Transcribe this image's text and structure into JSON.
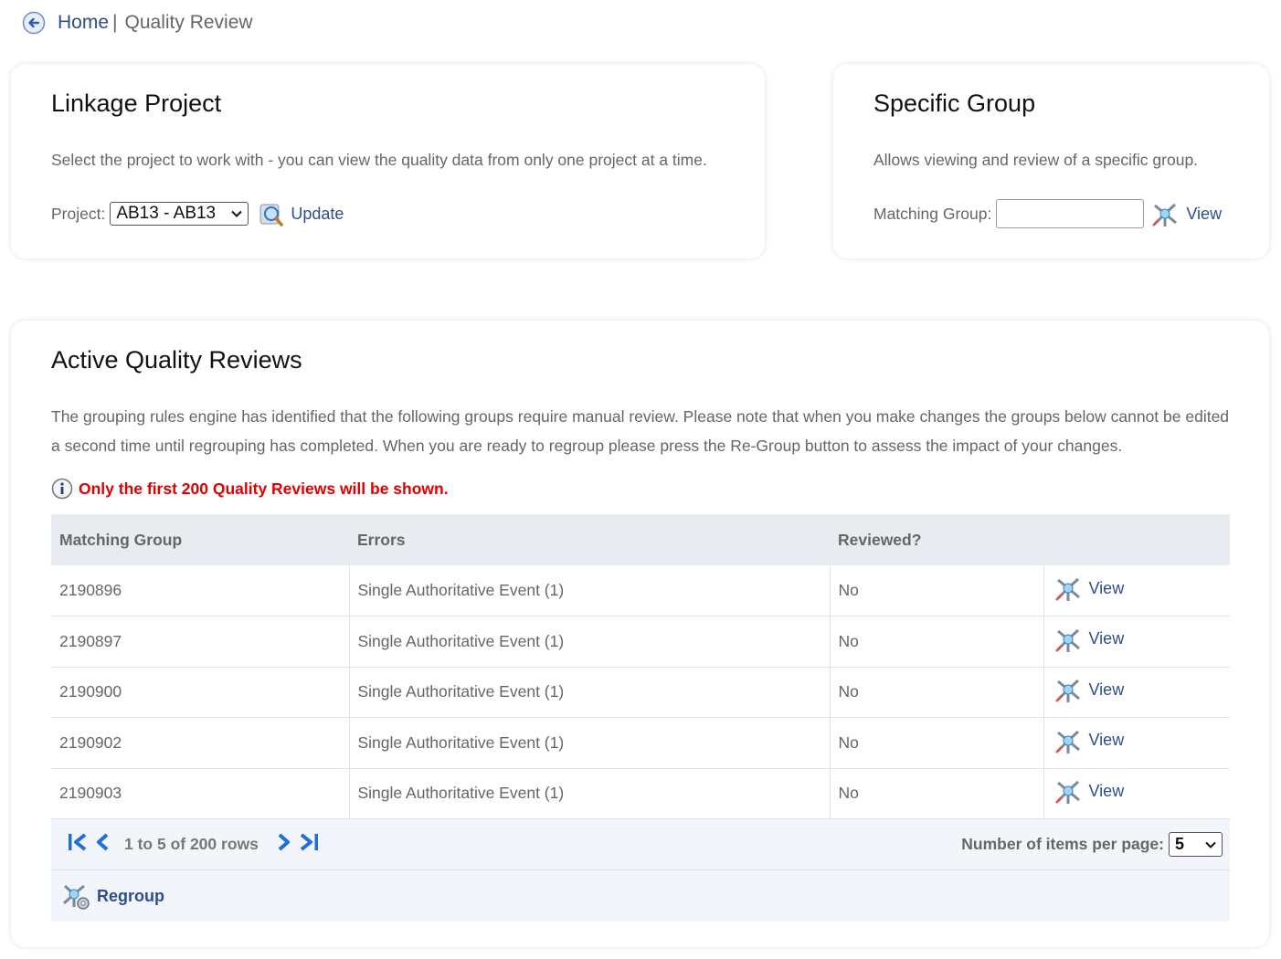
{
  "breadcrumb": {
    "home": "Home",
    "separator": "|",
    "current": "Quality Review"
  },
  "linkage": {
    "title": "Linkage Project",
    "description": "Select the project to work with - you can view the quality data from only one project at a time.",
    "project_label": "Project:",
    "project_value": "AB13 - AB13",
    "update_label": "Update"
  },
  "specific": {
    "title": "Specific Group",
    "description": "Allows viewing and review of a specific group.",
    "group_label": "Matching Group:",
    "group_value": "",
    "view_label": "View"
  },
  "active": {
    "title": "Active Quality Reviews",
    "description": "The grouping rules engine has identified that the following groups require manual review. Please note that when you make changes the groups below cannot be edited a second time until regrouping has completed. When you are ready to regroup please press the Re-Group button to assess the impact of your changes.",
    "notice": "Only the first 200 Quality Reviews will be shown.",
    "columns": [
      "Matching Group",
      "Errors",
      "Reviewed?"
    ],
    "rows": [
      {
        "group": "2190896",
        "errors": "Single Authoritative Event (1)",
        "reviewed": "No",
        "action": "View"
      },
      {
        "group": "2190897",
        "errors": "Single Authoritative Event (1)",
        "reviewed": "No",
        "action": "View"
      },
      {
        "group": "2190900",
        "errors": "Single Authoritative Event (1)",
        "reviewed": "No",
        "action": "View"
      },
      {
        "group": "2190902",
        "errors": "Single Authoritative Event (1)",
        "reviewed": "No",
        "action": "View"
      },
      {
        "group": "2190903",
        "errors": "Single Authoritative Event (1)",
        "reviewed": "No",
        "action": "View"
      }
    ],
    "pager": {
      "range_text": "1 to 5 of 200 rows",
      "items_label": "Number of items per page:",
      "items_value": "5"
    },
    "regroup_label": "Regroup"
  },
  "icons": {
    "back": "back-arrow-icon",
    "update": "magnifier-database-icon",
    "view": "molecule-view-icon",
    "info": "info-icon",
    "regroup": "molecule-gear-icon"
  },
  "colors": {
    "link": "#2d4e8a",
    "notice": "#e00000",
    "pager_blue": "#1f6fd6",
    "table_header": "#e8ecf1"
  }
}
